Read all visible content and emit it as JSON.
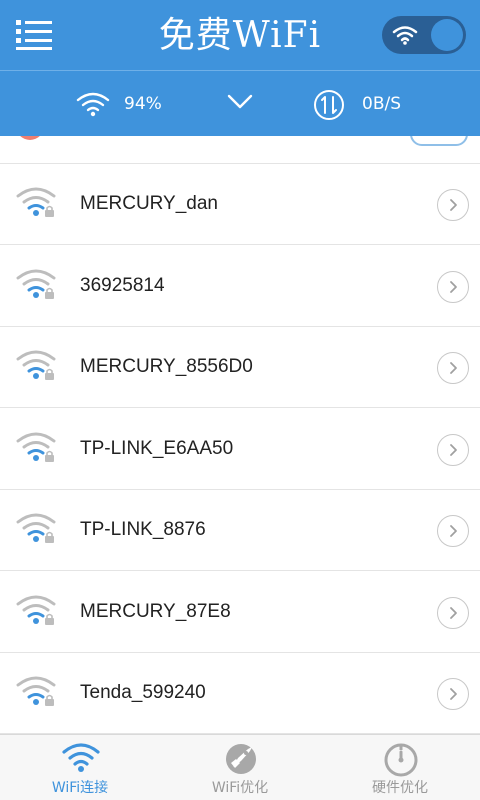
{
  "header": {
    "title": "免费WiFi",
    "menu_icon": "menu-icon",
    "toggle_icon": "wifi-icon",
    "colors": {
      "primary": "#3f93dc",
      "toggle_track": "#2a5f95"
    }
  },
  "status": {
    "signal_value": "94%",
    "speed_value": "0B/S",
    "icons": [
      "wifi-icon",
      "chevron-down-icon",
      "speed-icon"
    ]
  },
  "networks": [
    {
      "name": "MERCURY_dan",
      "locked": true
    },
    {
      "name": "36925814",
      "locked": true
    },
    {
      "name": "MERCURY_8556D0",
      "locked": true
    },
    {
      "name": "TP-LINK_E6AA50",
      "locked": true
    },
    {
      "name": "TP-LINK_8876",
      "locked": true
    },
    {
      "name": "MERCURY_87E8",
      "locked": true
    },
    {
      "name": "Tenda_599240",
      "locked": true
    }
  ],
  "tabs": [
    {
      "label": "WiFi连接",
      "icon": "wifi-icon",
      "active": true
    },
    {
      "label": "WiFi优化",
      "icon": "rocket-icon",
      "active": false
    },
    {
      "label": "硬件优化",
      "icon": "gauge-icon",
      "active": false
    }
  ],
  "colors": {
    "accent": "#3f93dc",
    "signal_gray": "#bdbdbd",
    "text": "#222222",
    "tab_inactive": "#9a9a9a"
  }
}
